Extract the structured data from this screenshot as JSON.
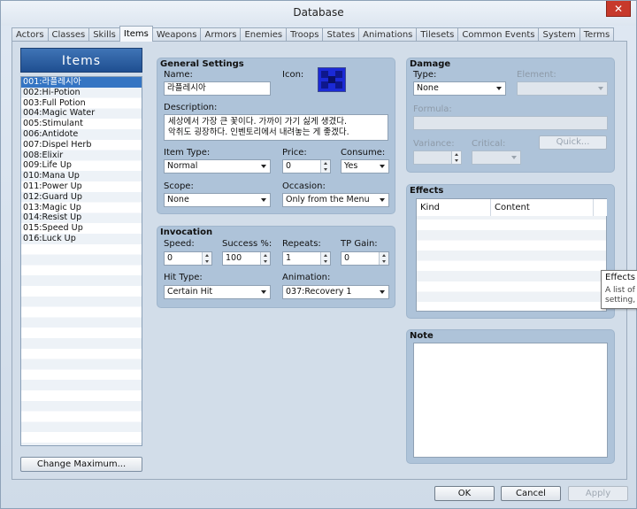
{
  "window": {
    "title": "Database",
    "close_glyph": "✕"
  },
  "tabs": [
    "Actors",
    "Classes",
    "Skills",
    "Items",
    "Weapons",
    "Armors",
    "Enemies",
    "Troops",
    "States",
    "Animations",
    "Tilesets",
    "Common Events",
    "System",
    "Terms"
  ],
  "active_tab": "Items",
  "list": {
    "header": "Items",
    "items": [
      "001:라플레시아",
      "002:Hi-Potion",
      "003:Full Potion",
      "004:Magic Water",
      "005:Stimulant",
      "006:Antidote",
      "007:Dispel Herb",
      "008:Elixir",
      "009:Life Up",
      "010:Mana Up",
      "011:Power Up",
      "012:Guard Up",
      "013:Magic Up",
      "014:Resist Up",
      "015:Speed Up",
      "016:Luck Up"
    ],
    "selected_index": 0,
    "change_max_label": "Change Maximum..."
  },
  "general": {
    "title": "General Settings",
    "name_label": "Name:",
    "name_value": "라플레시아",
    "icon_label": "Icon:",
    "desc_label": "Description:",
    "desc_line1": "세상에서 가장 큰 꽃이다. 가까이 가기 싫게 생겼다.",
    "desc_line2": "악취도 굉장하다. 인벤토리에서 내려놓는 게 좋겠다.",
    "item_type_label": "Item Type:",
    "item_type_value": "Normal",
    "price_label": "Price:",
    "price_value": "0",
    "consume_label": "Consume:",
    "consume_value": "Yes",
    "scope_label": "Scope:",
    "scope_value": "None",
    "occasion_label": "Occasion:",
    "occasion_value": "Only from the Menu"
  },
  "invocation": {
    "title": "Invocation",
    "speed_label": "Speed:",
    "speed_value": "0",
    "success_label": "Success %:",
    "success_value": "100",
    "repeats_label": "Repeats:",
    "repeats_value": "1",
    "tp_label": "TP Gain:",
    "tp_value": "0",
    "hit_type_label": "Hit Type:",
    "hit_type_value": "Certain Hit",
    "animation_label": "Animation:",
    "animation_value": "037:Recovery 1"
  },
  "damage": {
    "title": "Damage",
    "type_label": "Type:",
    "type_value": "None",
    "element_label": "Element:",
    "formula_label": "Formula:",
    "variance_label": "Variance:",
    "critical_label": "Critical:",
    "quick_label": "Quick..."
  },
  "effects": {
    "title": "Effects",
    "col_kind": "Kind",
    "col_content": "Content"
  },
  "note": {
    "title": "Note"
  },
  "tooltip": {
    "title": "Effects",
    "line1": "A list of v",
    "line2": "setting, d"
  },
  "footer": {
    "ok": "OK",
    "cancel": "Cancel",
    "apply": "Apply"
  },
  "colors": {
    "selection": "#3575c3",
    "list_header": "#2a5ea4",
    "panel": "#aec3d9",
    "icon_blue": "#1b2ad6"
  }
}
